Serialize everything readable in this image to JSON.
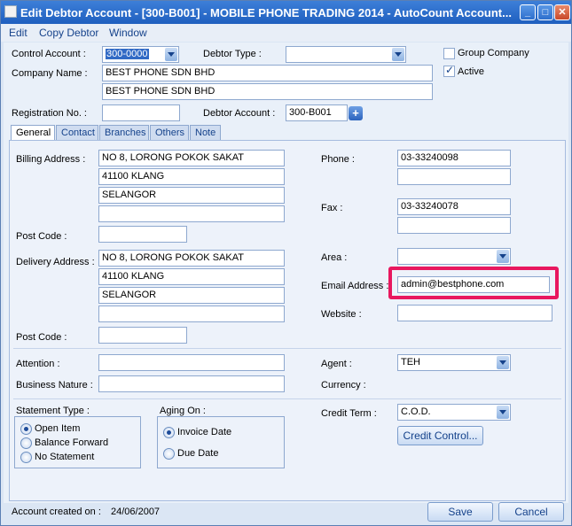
{
  "window": {
    "title": "Edit Debtor Account - [300-B001] - MOBILE PHONE TRADING 2014 - AutoCount Account...",
    "minimize_glyph": "_",
    "maximize_glyph": "□",
    "close_glyph": "✕"
  },
  "menu": [
    "Edit",
    "Copy Debtor",
    "Window"
  ],
  "header": {
    "control_account_label": "Control Account :",
    "control_account_value": "300-0000",
    "debtor_type_label": "Debtor Type :",
    "debtor_type_value": "",
    "group_company_label": "Group Company",
    "group_company_checked": false,
    "active_label": "Active",
    "active_checked": true,
    "company_name_label": "Company Name :",
    "company_name_1": "BEST PHONE SDN BHD",
    "company_name_2": "BEST PHONE SDN BHD",
    "registration_label": "Registration No. :",
    "registration_value": "",
    "debtor_account_label": "Debtor Account :",
    "debtor_account_value": "300-B001",
    "add_glyph": "+"
  },
  "tabs": [
    "General",
    "Contact",
    "Branches",
    "Others",
    "Note"
  ],
  "general": {
    "billing_address_label": "Billing Address :",
    "billing_address": [
      "NO 8, LORONG POKOK SAKAT",
      "41100 KLANG",
      "SELANGOR",
      ""
    ],
    "post_code_label": "Post Code :",
    "billing_post_code": "",
    "delivery_address_label": "Delivery Address :",
    "delivery_address": [
      "NO 8, LORONG POKOK SAKAT",
      "41100 KLANG",
      "SELANGOR",
      ""
    ],
    "delivery_post_code": "",
    "phone_label": "Phone :",
    "phone_1": "03-33240098",
    "phone_2": "",
    "fax_label": "Fax :",
    "fax_1": "03-33240078",
    "fax_2": "",
    "area_label": "Area :",
    "area_value": "",
    "email_label": "Email  Address :",
    "email_value": "admin@bestphone.com",
    "website_label": "Website :",
    "website_value": "",
    "attention_label": "Attention :",
    "attention_value": "",
    "business_nature_label": "Business Nature :",
    "business_nature_value": "",
    "agent_label": "Agent :",
    "agent_value": "TEH",
    "currency_label": "Currency :",
    "statement_type_label": "Statement Type :",
    "statement_options": [
      "Open Item",
      "Balance Forward",
      "No Statement"
    ],
    "statement_selected": 0,
    "aging_on_label": "Aging On :",
    "aging_options": [
      "Invoice Date",
      "Due Date"
    ],
    "aging_selected": 0,
    "credit_term_label": "Credit Term :",
    "credit_term_value": "C.O.D.",
    "credit_control_label": "Credit Control..."
  },
  "footer": {
    "account_created_label": "Account created on :",
    "account_created_value": "24/06/2007",
    "save_label": "Save",
    "cancel_label": "Cancel"
  },
  "colors": {
    "highlight": "#e8185f",
    "title_bar": "#2a6acb",
    "link_text": "#15428b"
  }
}
